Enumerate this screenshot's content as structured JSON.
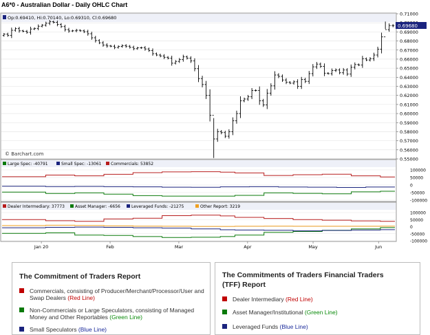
{
  "header": {
    "title": "A6*0 - Australian Dollar - Daily OHLC Chart"
  },
  "price_panel": {
    "ohlc_readout": "Op:0.69410, Hi:0.70140, Lo:0.69310, Cl:0.69680",
    "last_price_tag": "0.69680",
    "watermark": "© Barchart.com"
  },
  "cot_panel": {
    "legend": [
      {
        "label": "Large Spec: -40791",
        "color": "#0a7a0a"
      },
      {
        "label": "Small Spec: -13061",
        "color": "#1a237e"
      },
      {
        "label": "Commercials: 53852",
        "color": "#b71c1c"
      }
    ]
  },
  "tff_panel": {
    "legend": [
      {
        "label": "Dealer Intermediary: 37773",
        "color": "#b71c1c"
      },
      {
        "label": "Asset Manager: -6656",
        "color": "#0a7a0a"
      },
      {
        "label": "Leveraged Funds: -21275",
        "color": "#1a237e"
      },
      {
        "label": "Other Report: 3219",
        "color": "#f0a020"
      }
    ]
  },
  "chart_data": [
    {
      "type": "line",
      "title": "A6*0 - Australian Dollar - Daily OHLC Chart",
      "subtype": "ohlc",
      "x_tick_labels": [
        "Jan 20",
        "Feb",
        "Mar",
        "Apr",
        "May",
        "Jun"
      ],
      "ylim": [
        0.55,
        0.71
      ],
      "y_ticks": [
        "0.71000",
        "0.70000",
        "0.69000",
        "0.68000",
        "0.67000",
        "0.66000",
        "0.65000",
        "0.64000",
        "0.63000",
        "0.62000",
        "0.61000",
        "0.60000",
        "0.59000",
        "0.58000",
        "0.57000",
        "0.56000",
        "0.55000"
      ],
      "series": [
        {
          "close": [
            0.6875,
            0.6862,
            0.6918,
            0.6936,
            0.6912,
            0.6906,
            0.6895,
            0.6932,
            0.6938,
            0.6962,
            0.6975,
            0.6995,
            0.7012,
            0.7005,
            0.6982,
            0.6958,
            0.6925,
            0.691,
            0.6912,
            0.6918,
            0.6912,
            0.6902,
            0.688,
            0.6835,
            0.6805,
            0.678,
            0.6755,
            0.6745,
            0.6742,
            0.6728,
            0.674,
            0.6748,
            0.6742,
            0.673,
            0.6715,
            0.6725,
            0.6725,
            0.6712,
            0.6695,
            0.666,
            0.6645,
            0.6635,
            0.662,
            0.661,
            0.6555,
            0.6575,
            0.6595,
            0.6625,
            0.661,
            0.658,
            0.6495,
            0.6385,
            0.632,
            0.62,
            0.598,
            0.572,
            0.58,
            0.579,
            0.575,
            0.58,
            0.592,
            0.6,
            0.614,
            0.616,
            0.6185,
            0.6255,
            0.6255,
            0.614,
            0.6095,
            0.6225,
            0.6305,
            0.6425,
            0.641,
            0.637,
            0.6345,
            0.6335,
            0.635,
            0.63,
            0.6375,
            0.6355,
            0.644,
            0.6515,
            0.6545,
            0.652,
            0.6445,
            0.644,
            0.6475,
            0.648,
            0.645,
            0.648,
            0.6435,
            0.651,
            0.654,
            0.6535,
            0.6605,
            0.659,
            0.6605,
            0.6645,
            0.671,
            0.6845,
            0.6925,
            0.697,
            0.6968
          ]
        }
      ]
    },
    {
      "type": "line",
      "title": "The Commitment of Traders Report",
      "ylim": [
        -100000,
        100000
      ],
      "y_ticks": [
        "100000",
        "50000",
        "0",
        "-50000",
        "-100000"
      ],
      "series": [
        {
          "name": "Large Spec",
          "values": [
            -47000,
            -47000,
            -47000,
            -56000,
            -56000,
            -52000,
            -52000,
            -60000,
            -60000,
            -70000,
            -70000,
            -73000,
            -73000,
            -73000,
            -73000,
            -73000,
            -68000,
            -68000,
            -52000,
            -52000,
            -55000,
            -55000,
            -58000,
            -58000,
            -45000,
            -45000,
            -40791
          ]
        },
        {
          "name": "Small Spec",
          "values": [
            -8000,
            -8000,
            -8000,
            -10000,
            -10000,
            -9000,
            -9000,
            -11000,
            -11000,
            -12000,
            -12000,
            -14000,
            -14000,
            -15000,
            -15000,
            -12000,
            -12000,
            -11000,
            -11000,
            -13000,
            -13000,
            -14000,
            -14000,
            -16000,
            -16000,
            -13061,
            -13061
          ]
        },
        {
          "name": "Commercials",
          "values": [
            55000,
            55000,
            55000,
            66000,
            66000,
            61000,
            61000,
            71000,
            71000,
            82000,
            82000,
            87000,
            87000,
            88000,
            88000,
            85000,
            80000,
            80000,
            63000,
            63000,
            68000,
            68000,
            72000,
            72000,
            61000,
            61000,
            53852
          ]
        }
      ]
    },
    {
      "type": "line",
      "title": "The Commitments of Traders Financial Traders (TFF) Report",
      "ylim": [
        -100000,
        100000
      ],
      "y_ticks": [
        "100000",
        "50000",
        "0",
        "-50000",
        "-100000"
      ],
      "series": [
        {
          "name": "Dealer Intermediary",
          "values": [
            50000,
            50000,
            50000,
            42000,
            42000,
            38000,
            38000,
            55000,
            55000,
            60000,
            60000,
            78000,
            78000,
            82000,
            82000,
            76000,
            66000,
            66000,
            58000,
            58000,
            50000,
            50000,
            46000,
            46000,
            41000,
            41000,
            37773
          ]
        },
        {
          "name": "Asset Manager",
          "values": [
            -48000,
            -48000,
            -48000,
            -44000,
            -44000,
            -60000,
            -60000,
            -62000,
            -62000,
            -70000,
            -70000,
            -77000,
            -77000,
            -75000,
            -75000,
            -70000,
            -60000,
            -60000,
            -40000,
            -40000,
            -34000,
            -34000,
            -26000,
            -26000,
            -16000,
            -16000,
            -6656
          ]
        },
        {
          "name": "Leveraged Funds",
          "values": [
            -8000,
            -8000,
            -8000,
            -5000,
            -5000,
            -3000,
            -3000,
            -5000,
            -5000,
            -8000,
            -8000,
            -10000,
            -10000,
            -16000,
            -16000,
            -22000,
            -24000,
            -24000,
            -26000,
            -26000,
            -30000,
            -30000,
            -27000,
            -27000,
            -24000,
            -24000,
            -21275
          ]
        },
        {
          "name": "Other Report",
          "values": [
            8000,
            8000,
            8000,
            10000,
            10000,
            9000,
            9000,
            6000,
            6000,
            4000,
            4000,
            3000,
            3000,
            2000,
            2000,
            2000,
            3000,
            3000,
            4000,
            4000,
            3000,
            3000,
            3000,
            3000,
            3000,
            3000,
            3219
          ]
        }
      ]
    }
  ],
  "legend_cot": {
    "heading": "The Commitment of Traders Report",
    "items": [
      {
        "text": "Commercials, consisting of Producer/Merchant/Processor/User and Swap Dealers",
        "tag": "(Red Line)",
        "color": "#c00000"
      },
      {
        "text": "Non-Commercials or Large Speculators, consisting of Managed Money and Other Reportables",
        "tag": "(Green Line)",
        "color": "#0a7a0a"
      },
      {
        "text": "Small Speculators",
        "tag": "(Blue Line)",
        "color": "#1a237e"
      }
    ]
  },
  "legend_tff": {
    "heading": "The Commitments of Traders Financial Traders (TFF) Report",
    "items": [
      {
        "text": "Dealer Intermediary",
        "tag": "(Red Line)",
        "color": "#c00000"
      },
      {
        "text": "Asset Manager/Institutional",
        "tag": "(Green Line)",
        "color": "#0a7a0a"
      },
      {
        "text": "Leveraged Funds",
        "tag": "(Blue Line)",
        "color": "#1a237e"
      }
    ]
  }
}
